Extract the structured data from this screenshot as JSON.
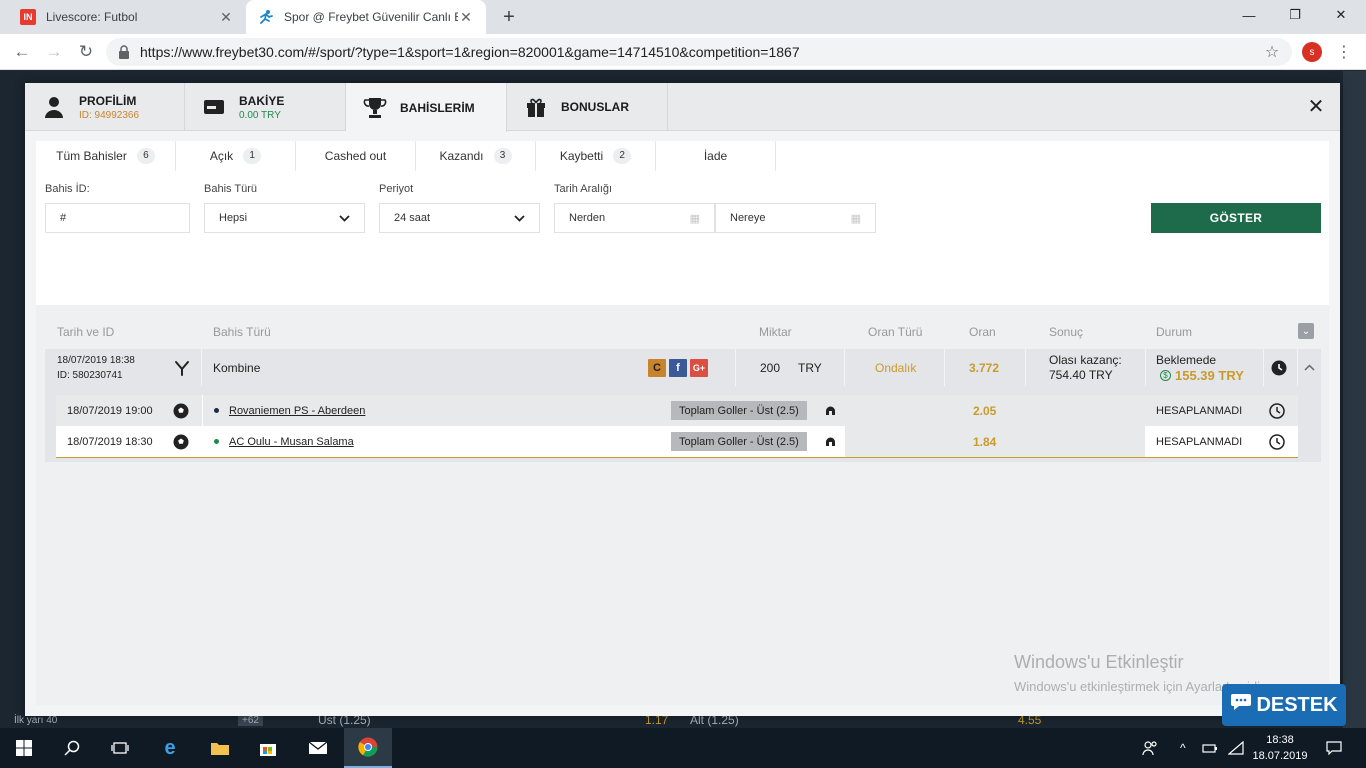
{
  "browser": {
    "tabs": [
      {
        "title": "Livescore: Futbol",
        "favicon": "IN"
      },
      {
        "title": "Spor @ Freybet Güvenilir Canlı B",
        "favicon": "freybet-runner"
      }
    ],
    "new_tab": "+",
    "url": "https://www.freybet30.com/#/sport/?type=1&sport=1&region=820001&game=14714510&competition=1867",
    "profile_initial": "s",
    "window_minimize": "—",
    "window_maximize": "❐",
    "window_close": "✕",
    "menu": "⋮"
  },
  "modal": {
    "tabs": [
      {
        "title": "PROFİLİM",
        "subtitle": "ID: 94992366"
      },
      {
        "title": "BAKİYE",
        "subtitle": "0.00 TRY"
      },
      {
        "title": "BAHİSLERİM",
        "subtitle": ""
      },
      {
        "title": "BONUSLAR",
        "subtitle": ""
      }
    ],
    "close": "✕",
    "status_tabs": [
      {
        "label": "Tüm Bahisler",
        "count": "6"
      },
      {
        "label": "Açık",
        "count": "1"
      },
      {
        "label": "Cashed out",
        "count": ""
      },
      {
        "label": "Kazandı",
        "count": "3"
      },
      {
        "label": "Kaybetti",
        "count": "2"
      },
      {
        "label": "İade",
        "count": ""
      }
    ],
    "filters": {
      "bet_id_label": "Bahis İD:",
      "bet_id_value": "#",
      "bet_type_label": "Bahis Türü",
      "bet_type_value": "Hepsi",
      "period_label": "Periyot",
      "period_value": "24 saat",
      "date_range_label": "Tarih Aralığı",
      "from_value": "Nerden",
      "to_value": "Nereye",
      "show_button": "GÖSTER"
    },
    "table": {
      "headers": [
        "Tarih ve ID",
        "Bahis Türü",
        "Miktar",
        "Oran Türü",
        "Oran",
        "Sonuç",
        "Durum"
      ],
      "bet": {
        "date": "18/07/2019 18:38",
        "id": "ID: 580230741",
        "type": "Kombine",
        "amount": "200",
        "currency": "TRY",
        "odds_type": "Ondalık",
        "odds": "3.772",
        "possible_win_label": "Olası kazanç:",
        "possible_win": "754.40 TRY",
        "status": "Beklemede",
        "cashout": "155.39 TRY"
      },
      "selections": [
        {
          "date": "18/07/2019 19:00",
          "match": "Rovaniemen PS - Aberdeen",
          "market": "Toplam Goller - Üst (2.5)",
          "odds": "2.05",
          "status": "HESAPLANMADI",
          "dot": "#1c2a4a"
        },
        {
          "date": "18/07/2019 18:30",
          "match": "AC Oulu - Musan Salama",
          "market": "Toplam Goller - Üst (2.5)",
          "odds": "1.84",
          "status": "HESAPLANMADI",
          "dot": "#1e8a4a"
        }
      ]
    }
  },
  "background": {
    "snippets": [
      "İlk yarı 40",
      "+62",
      "Üst (1.25)",
      "1.17",
      "Alt (1.25)",
      "4.55"
    ]
  },
  "watermark": {
    "line1": "Windows'u Etkinleştir",
    "line2": "Windows'u etkinleştirmek için Ayarlar'a gidin."
  },
  "support_button": "DESTEK",
  "taskbar": {
    "time": "18:38",
    "date": "18.07.2019"
  },
  "colors": {
    "accent_green": "#1e6b4b",
    "odds_gold": "#c89b2d",
    "profile_id": "#c8832d",
    "balance": "#1e8a4a"
  }
}
